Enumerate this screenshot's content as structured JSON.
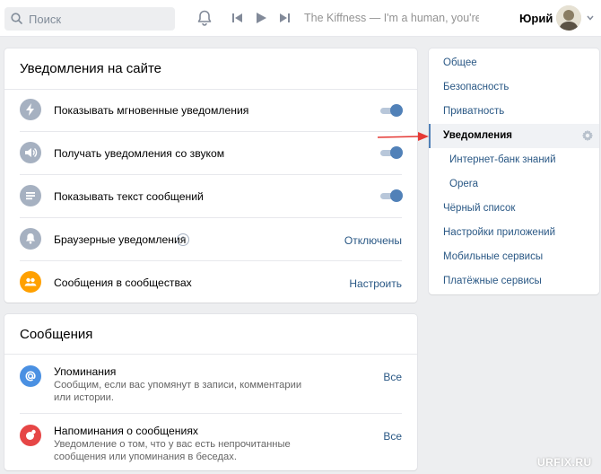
{
  "header": {
    "search_placeholder": "Поиск",
    "track": "The Kiffness — I'm a human, you're a ...",
    "user_name": "Юрий"
  },
  "site_notifications": {
    "title": "Уведомления на сайте",
    "rows": [
      {
        "label": "Показывать мгновенные уведомления",
        "icon": "lightning-icon",
        "control": "toggle",
        "on": true
      },
      {
        "label": "Получать уведомления со звуком",
        "icon": "speaker-icon",
        "control": "toggle",
        "on": true
      },
      {
        "label": "Показывать текст сообщений",
        "icon": "text-lines-icon",
        "control": "toggle",
        "on": true
      },
      {
        "label": "Браузерные уведомления",
        "icon": "bell-icon",
        "help": "?",
        "value": "Отключены"
      },
      {
        "label": "Сообщения в сообществах",
        "icon": "community-icon",
        "value": "Настроить"
      }
    ]
  },
  "messages": {
    "title": "Сообщения",
    "rows": [
      {
        "label": "Упоминания",
        "description": "Сообщим, если вас упомянут в записи, комментарии или истории.",
        "value": "Все",
        "icon": "at-icon"
      },
      {
        "label": "Напоминания о сообщениях",
        "description": "Уведомление о том, что у вас есть непрочитанные сообщения или упоминания в беседах.",
        "value": "Все",
        "icon": "reminder-icon"
      }
    ]
  },
  "menu": {
    "items": [
      {
        "label": "Общее"
      },
      {
        "label": "Безопасность"
      },
      {
        "label": "Приватность"
      },
      {
        "label": "Уведомления"
      },
      {
        "label": "Интернет-банк знаний"
      },
      {
        "label": "Opera"
      },
      {
        "label": "Чёрный список"
      },
      {
        "label": "Настройки приложений"
      },
      {
        "label": "Мобильные сервисы"
      },
      {
        "label": "Платёжные сервисы"
      }
    ]
  },
  "watermark": "URFIX.RU",
  "colors": {
    "accent": "#5181b8",
    "link": "#2a5885",
    "lightning": "#a6b1c1",
    "community": "#ffa000",
    "at": "#4a90e2",
    "reminder": "#e64646",
    "arrow": "#e53935"
  }
}
